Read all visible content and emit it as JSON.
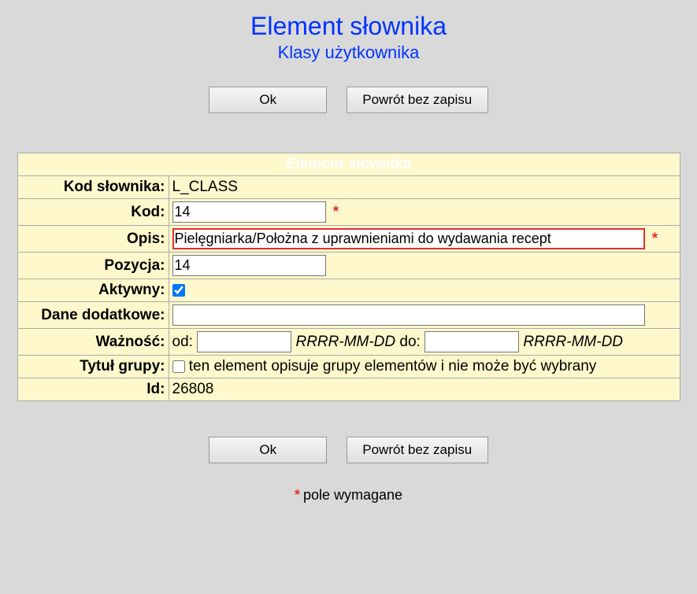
{
  "header": {
    "title": "Element słownika",
    "subtitle": "Klasy użytkownika"
  },
  "buttons": {
    "ok": "Ok",
    "back": "Powrót bez zapisu"
  },
  "table": {
    "title": "Element słownika",
    "labels": {
      "kodSlownika": "Kod słownika:",
      "kod": "Kod:",
      "opis": "Opis:",
      "pozycja": "Pozycja:",
      "aktywny": "Aktywny:",
      "daneDodatkowe": "Dane dodatkowe:",
      "waznosc": "Ważność:",
      "tytulGrupy": "Tytuł grupy:",
      "id": "Id:"
    },
    "values": {
      "kodSlownika": "L_CLASS",
      "kod": "14",
      "opis": "Pielęgniarka/Położna z uprawnieniami do wydawania recept",
      "pozycja": "14",
      "daneDodatkowe": "",
      "waznoscOd": "",
      "waznoscDo": "",
      "id": "26808"
    },
    "dateLabels": {
      "od": "od:",
      "do": "do:",
      "hint": "RRRR-MM-DD"
    },
    "grupyText": "ten element opisuje grupy elementów i nie może być wybrany"
  },
  "requiredMark": "*",
  "footer": "pole wymagane"
}
